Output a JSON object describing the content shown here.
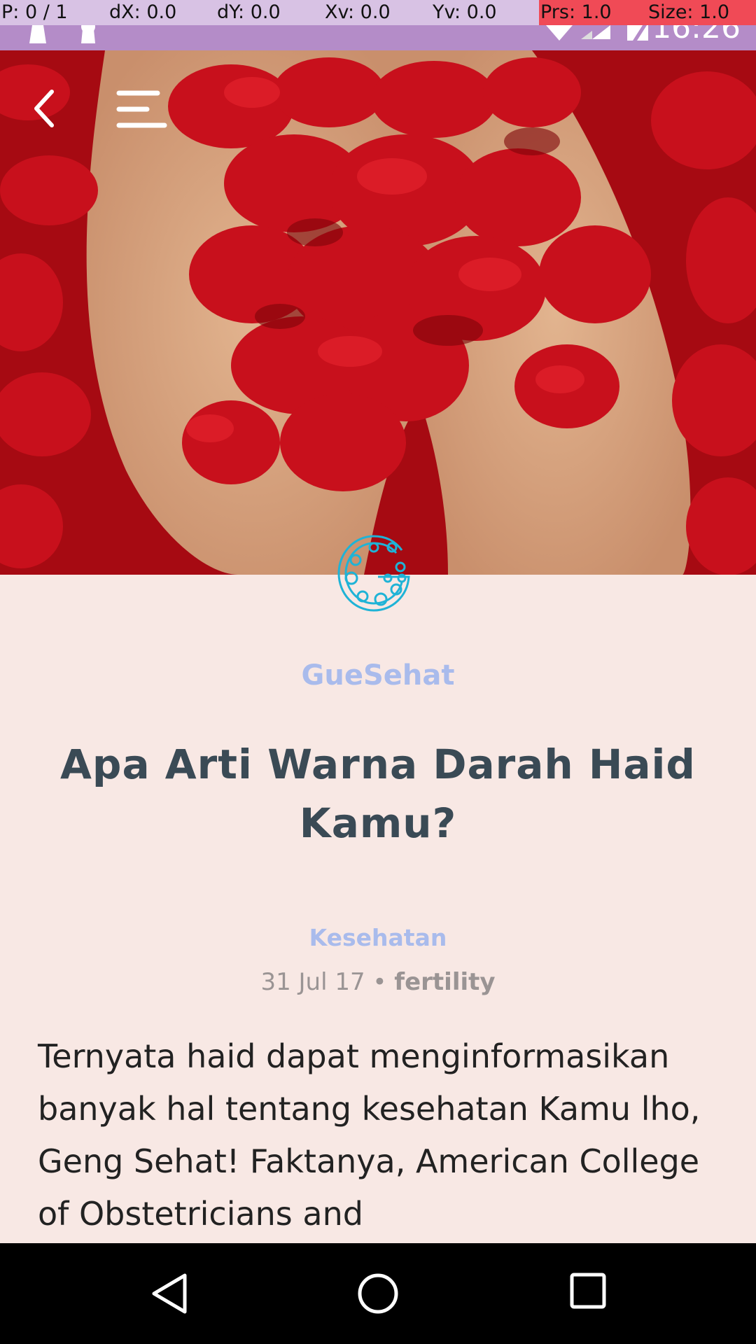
{
  "debug": {
    "pointer": "P: 0 / 1",
    "dx": "dX: 0.0",
    "dy": "dY: 0.0",
    "xv": "Xv: 0.0",
    "yv": "Yv: 0.0",
    "prs": "Prs: 1.0",
    "size": "Size: 1.0"
  },
  "status_bar": {
    "time": "16:26",
    "icons": [
      "notification-icon",
      "notification-icon",
      "wifi-icon",
      "signal-icon",
      "battery-icon"
    ]
  },
  "toolbar": {
    "back_icon": "chevron-left-icon",
    "menu_icon": "menu-icon"
  },
  "article": {
    "source": "GueSehat",
    "title": "Apa Arti Warna Darah Haid Kamu?",
    "category": "Kesehatan",
    "date": "31 Jul 17",
    "separator": "•",
    "tag": "fertility",
    "body": "Ternyata haid dapat menginformasikan banyak hal tentang kesehatan Kamu lho, Geng Sehat! Faktanya, American College of Obstetricians and"
  },
  "nav_bar": {
    "back_icon": "triangle-back-icon",
    "home_icon": "circle-home-icon",
    "recents_icon": "square-recents-icon"
  },
  "colors": {
    "accent": "#a9bbec",
    "title": "#3a4a55",
    "background": "#f8e8e4",
    "logo": "#1fb3d6",
    "status_bar": "#b48cc8"
  }
}
